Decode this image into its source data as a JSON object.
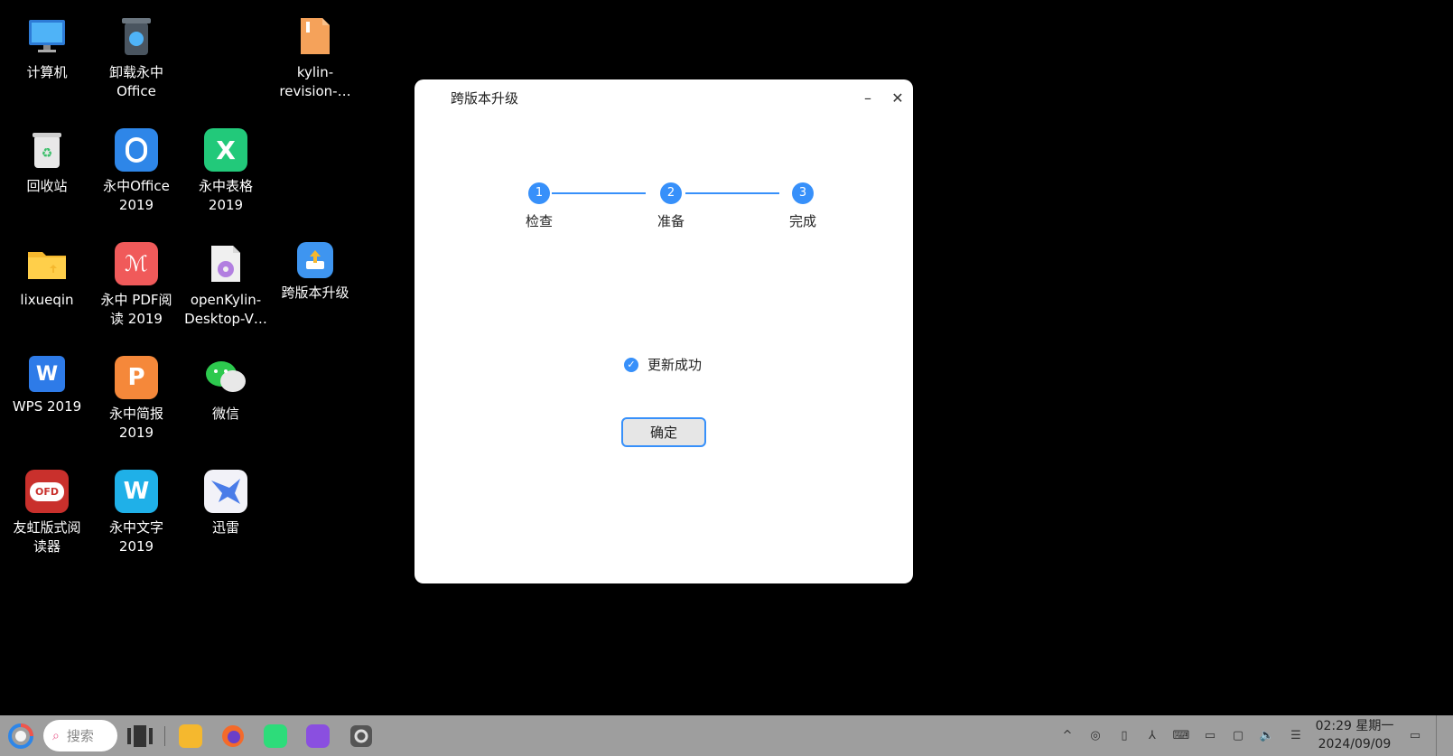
{
  "desktop": {
    "icons": [
      {
        "label": "计算机",
        "icon": "monitor-icon"
      },
      {
        "label": "卸载永中\nOffice",
        "icon": "trash-uninstall-icon"
      },
      {
        "label": "kylin-\nrevision-…",
        "icon": "archive-icon"
      },
      {
        "label": "回收站",
        "icon": "recycle-bin-icon"
      },
      {
        "label": "永中Office\n2019",
        "icon": "yozo-office-icon"
      },
      {
        "label": "永中表格\n2019",
        "icon": "yozo-sheet-icon"
      },
      {
        "label": "lixueqin",
        "icon": "folder-icon"
      },
      {
        "label": "永中 PDF阅\n读 2019",
        "icon": "yozo-pdf-icon"
      },
      {
        "label": "openKylin-\nDesktop-V…",
        "icon": "disc-image-icon"
      },
      {
        "label": "跨版本升级",
        "icon": "upgrade-icon"
      },
      {
        "label": "WPS 2019",
        "icon": "wps-icon"
      },
      {
        "label": "永中简报\n2019",
        "icon": "yozo-slides-icon"
      },
      {
        "label": "微信",
        "icon": "wechat-icon"
      },
      {
        "label": "友虹版式阅\n读器",
        "icon": "ofd-reader-icon"
      },
      {
        "label": "永中文字\n2019",
        "icon": "yozo-writer-icon"
      },
      {
        "label": "迅雷",
        "icon": "xunlei-icon"
      }
    ]
  },
  "dialog": {
    "title": "跨版本升级",
    "minimize": "–",
    "close": "✕",
    "steps": [
      {
        "num": "1",
        "label": "检查"
      },
      {
        "num": "2",
        "label": "准备"
      },
      {
        "num": "3",
        "label": "完成"
      }
    ],
    "result_text": "更新成功",
    "ok_label": "确定"
  },
  "taskbar": {
    "search_label": "搜索",
    "time": "02:29 星期一",
    "date": "2024/09/09"
  },
  "colors": {
    "accent": "#3790fa",
    "taskbar": "#9e9e9e"
  }
}
